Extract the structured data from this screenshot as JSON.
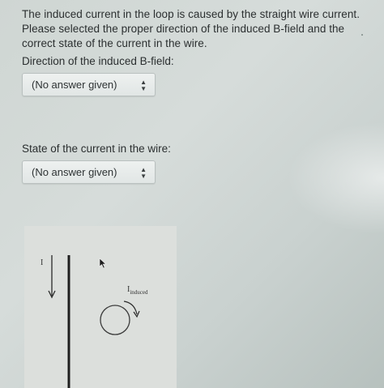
{
  "question": {
    "text": "The induced current in the loop is caused by the straight wire current. Please selected the proper direction of the induced B-field and the correct state of the current in the wire."
  },
  "bfield": {
    "label": "Direction of the induced B-field:",
    "selected": "(No answer given)"
  },
  "wire_state": {
    "label": "State of the current in the wire:",
    "selected": "(No answer given)"
  },
  "diagram": {
    "wire_label": "I",
    "induced_label_main": "I",
    "induced_label_sub": "induced"
  },
  "icons": {
    "select_arrows": "updown-arrows-icon",
    "cursor": "mouse-pointer-icon"
  }
}
